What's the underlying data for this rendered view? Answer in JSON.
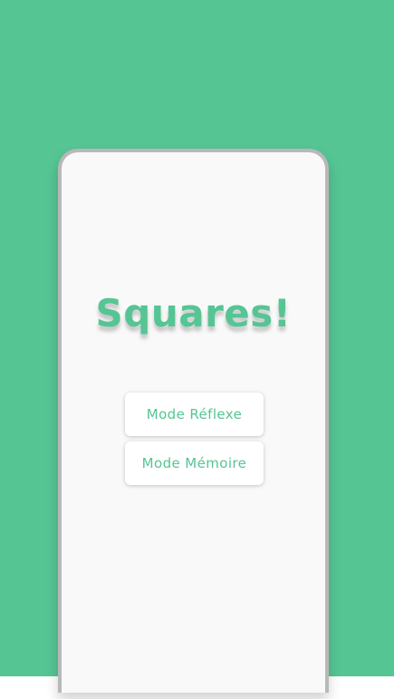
{
  "app": {
    "title": "Squares!"
  },
  "menu": {
    "buttons": [
      {
        "label": "Mode Réflexe"
      },
      {
        "label": "Mode Mémoire"
      }
    ]
  },
  "colors": {
    "accent": "#55c594",
    "card_background": "#f9f9f9",
    "card_border": "#b8b8b8",
    "button_background": "#ffffff"
  }
}
